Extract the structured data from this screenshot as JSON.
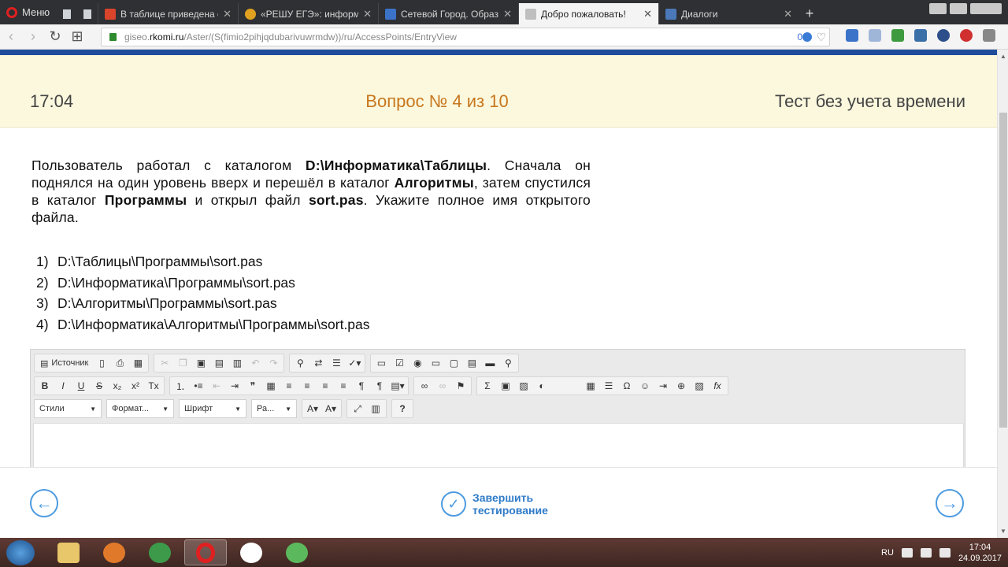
{
  "browser": {
    "menu_label": "Меню",
    "tabs": [
      {
        "title": "В таблице приведена сто",
        "favicon_color": "#d9442b",
        "active": false
      },
      {
        "title": "«РЕШУ ЕГЭ»: информати",
        "favicon_color": "#e0a020",
        "active": false
      },
      {
        "title": "Сетевой Город. Образов",
        "favicon_color": "#3b73c9",
        "active": false
      },
      {
        "title": "Добро пожаловать!",
        "favicon_color": "#bfbfbf",
        "active": true
      },
      {
        "title": "Диалоги",
        "favicon_color": "#4a78b8",
        "active": false
      }
    ],
    "url_prefix": "giseo.",
    "url_host": "rkomi.ru",
    "url_path": "/Aster/(S(fimio2pihjqdubarivuwrmdw))/ru/AccessPoints/EntryView",
    "badge_count": "0"
  },
  "header": {
    "time": "17:04",
    "question_counter": "Вопрос № 4 из 10",
    "mode": "Тест без учета времени"
  },
  "question": {
    "t1": "Пользователь работал с каталогом ",
    "b1": "D:\\Информатика\\Таблицы",
    "t2": ". Сначала он поднялся на один уровень вверх и перешёл в каталог ",
    "b2": "Алгоритмы",
    "t3": ", затем спустился в каталог ",
    "b3": "Программы",
    "t4": " и открыл файл ",
    "b4": "sort.pas",
    "t5": ". Укажите полное имя открытого файла.",
    "answers": [
      {
        "num": "1)",
        "text": "D:\\Таблицы\\Программы\\sort.pas"
      },
      {
        "num": "2)",
        "text": "D:\\Информатика\\Программы\\sort.pas"
      },
      {
        "num": "3)",
        "text": "D:\\Алгоритмы\\Программы\\sort.pas"
      },
      {
        "num": "4)",
        "text": "D:\\Информатика\\Алгоритмы\\Программы\\sort.pas"
      }
    ]
  },
  "editor": {
    "source_label": "Источник",
    "styles_label": "Стили",
    "format_label": "Формат...",
    "font_label": "Шрифт",
    "size_label": "Ра..."
  },
  "footer": {
    "finish_line1": "Завершить",
    "finish_line2": "тестирование"
  },
  "taskbar": {
    "lang": "RU",
    "time": "17:04",
    "date": "24.09.2017"
  }
}
